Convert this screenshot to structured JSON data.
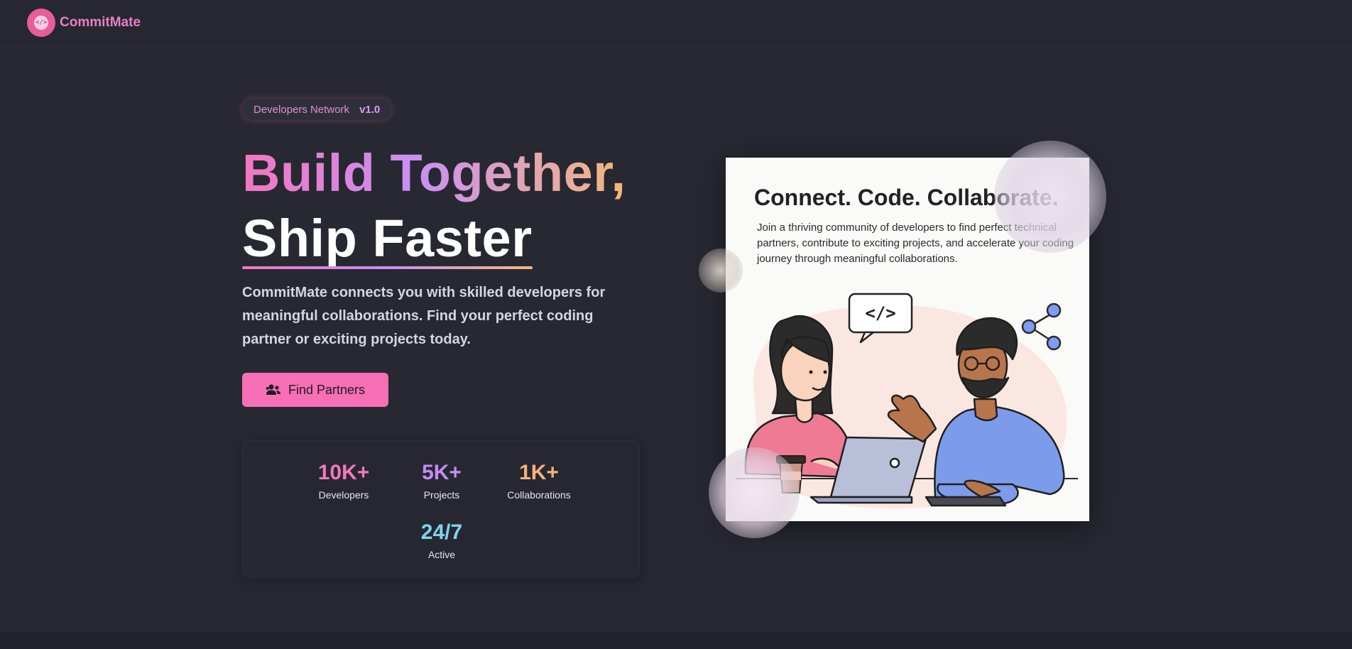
{
  "brand": {
    "name": "CommitMate",
    "logo_glyph": "</>"
  },
  "hero": {
    "pill_label": "Developers Network",
    "pill_version": "v1.0",
    "headline_line1": "Build Together,",
    "headline_line2": "Ship Faster",
    "description": "CommitMate connects you with skilled developers for meaningful collaborations. Find your perfect coding partner or exciting projects today.",
    "cta_label": "Find Partners",
    "cta_icon": "users-icon"
  },
  "stats": [
    {
      "value": "10K+",
      "label": "Developers",
      "color": "#f477bd"
    },
    {
      "value": "5K+",
      "label": "Projects",
      "color": "#c58cf4"
    },
    {
      "value": "1K+",
      "label": "Collaborations",
      "color": "#f6b27a"
    },
    {
      "value": "24/7",
      "label": "Active",
      "color": "#7fd4ec"
    }
  ],
  "card": {
    "title": "Connect. Code. Collaborate.",
    "text": "Join a thriving community of developers to find perfect technical partners, contribute to exciting projects, and accelerate your coding journey through meaningful collaborations.",
    "speech_bubble_code": "</>",
    "icons": [
      "code-bubble-icon",
      "share-icon",
      "laptop-icon",
      "coffee-cup-icon"
    ]
  },
  "colors": {
    "background": "#272832",
    "accent_pink": "#f76fb6",
    "accent_purple": "#c98ff4",
    "accent_orange": "#f4b87a"
  }
}
